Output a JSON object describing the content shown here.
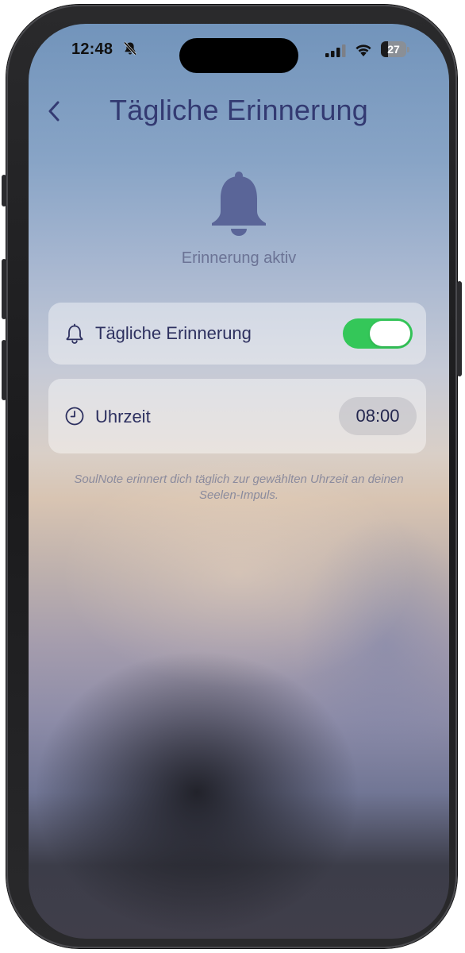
{
  "status_bar": {
    "time": "12:48",
    "battery": "27",
    "battery_level_percent": 27,
    "icons": [
      "bell-slash-icon",
      "cellular-signal-icon",
      "wifi-icon",
      "battery-icon"
    ]
  },
  "header": {
    "title": "Tägliche Erinnerung",
    "back_icon": "chevron-left-icon"
  },
  "hero": {
    "icon": "bell-icon",
    "status": "Erinnerung aktiv"
  },
  "settings": {
    "reminder": {
      "icon": "bell-outline-icon",
      "label": "Tägliche Erinnerung",
      "enabled": true
    },
    "time": {
      "icon": "clock-icon",
      "label": "Uhrzeit",
      "value": "08:00"
    }
  },
  "footnote": "SoulNote erinnert dich täglich zur gewählten Uhrzeit an deinen Seelen-Impuls.",
  "colors": {
    "accent_text": "#333a72",
    "toggle_on": "#34c759",
    "bell_fill": "#5a6598"
  }
}
